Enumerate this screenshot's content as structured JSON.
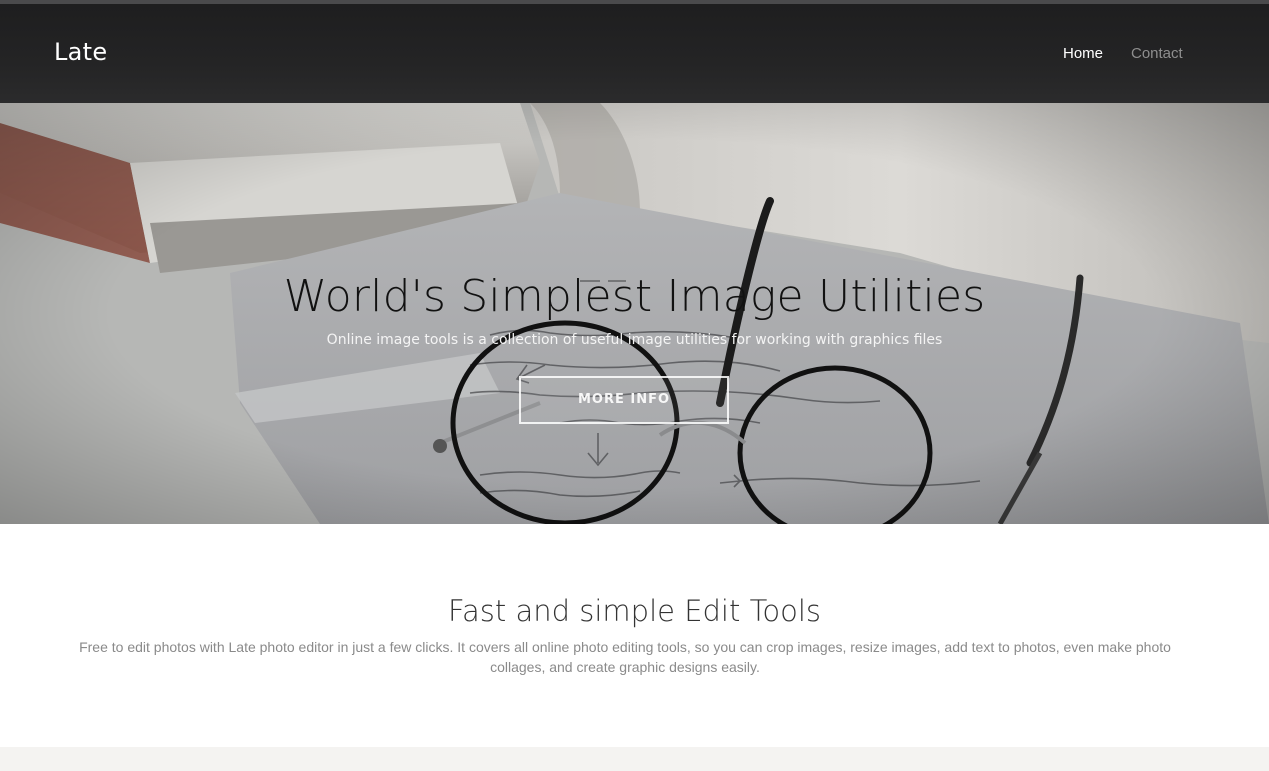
{
  "navbar": {
    "brand": "Late",
    "links": [
      {
        "label": "Home",
        "active": true
      },
      {
        "label": "Contact",
        "active": false
      }
    ]
  },
  "hero": {
    "title": "World's Simplest Image Utilities",
    "subtitle": "Online image tools is a collection of useful image utilities for working with graphics files",
    "button_label": "MORE INFO"
  },
  "features": {
    "title": "Fast and simple Edit Tools",
    "text": "Free to edit photos with Late photo editor in just a few clicks. It covers all online photo editing tools, so you can crop images, resize images, add text to photos, even make photo collages, and create graphic designs easily."
  },
  "colors": {
    "navbar_bg": "#222223",
    "nav_active": "#ffffff",
    "nav_inactive": "#8e8e8e",
    "body_text": "#8a8a8a",
    "footer_band": "#f4f3f1"
  }
}
